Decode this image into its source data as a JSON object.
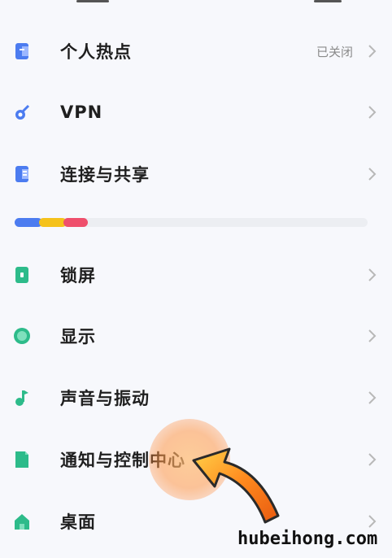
{
  "settings": {
    "items": [
      {
        "label": "个人热点",
        "value": "已关闭"
      },
      {
        "label": "VPN",
        "value": ""
      },
      {
        "label": "连接与共享",
        "value": ""
      },
      {
        "label": "锁屏",
        "value": ""
      },
      {
        "label": "显示",
        "value": ""
      },
      {
        "label": "声音与振动",
        "value": ""
      },
      {
        "label": "通知与控制中心",
        "value": ""
      },
      {
        "label": "桌面",
        "value": ""
      }
    ],
    "icons": [
      "hotspot-icon",
      "vpn-key-icon",
      "share-icon",
      "lock-screen-icon",
      "display-icon",
      "sound-icon",
      "notification-icon",
      "home-icon"
    ]
  },
  "colors": {
    "blue": "#4c7cf0",
    "yellow": "#f5c21b",
    "red": "#ef4f6c",
    "green": "#2dbb8a"
  },
  "watermark": "hubeihong.com"
}
